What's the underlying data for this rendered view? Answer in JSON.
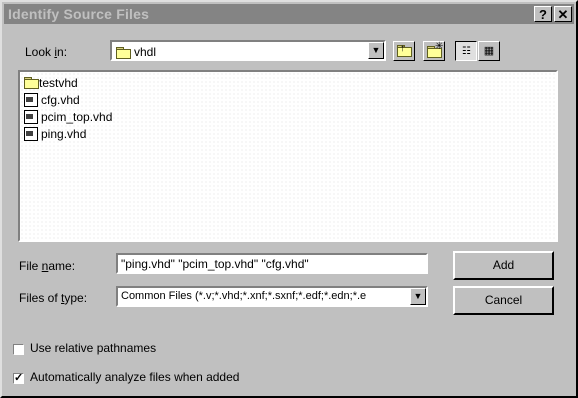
{
  "window": {
    "title": "Identify Source Files",
    "help_glyph": "?",
    "close_glyph": "✕"
  },
  "look_in": {
    "label_pre": "Look ",
    "label_key": "i",
    "label_post": "n:",
    "value": "vhdl",
    "folder_icon": "folder-icon"
  },
  "toolbar": {
    "up_icon": "up-folder-icon",
    "new_folder_icon": "new-folder-icon",
    "list_view_icon": "list-view-icon",
    "details_view_icon": "details-view-icon"
  },
  "files": [
    {
      "name": "testvhd",
      "type": "folder"
    },
    {
      "name": "cfg.vhd",
      "type": "file"
    },
    {
      "name": "pcim_top.vhd",
      "type": "file"
    },
    {
      "name": "ping.vhd",
      "type": "file"
    }
  ],
  "file_name": {
    "label_pre": "File ",
    "label_key": "n",
    "label_post": "ame:",
    "value": "\"ping.vhd\" \"pcim_top.vhd\" \"cfg.vhd\""
  },
  "file_type": {
    "label_pre": "Files of ",
    "label_key": "t",
    "label_post": "ype:",
    "value": "Common Files (*.v;*.vhd;*.xnf;*.sxnf;*.edf;*.edn;*.e"
  },
  "buttons": {
    "add": "Add",
    "cancel": "Cancel"
  },
  "options": {
    "relative": {
      "label": "Use relative pathnames",
      "checked": false
    },
    "analyze": {
      "label": "Automatically analyze files when added",
      "checked": true
    }
  },
  "colors": {
    "face": "#c0c0c0",
    "title_inactive": "#848484"
  }
}
